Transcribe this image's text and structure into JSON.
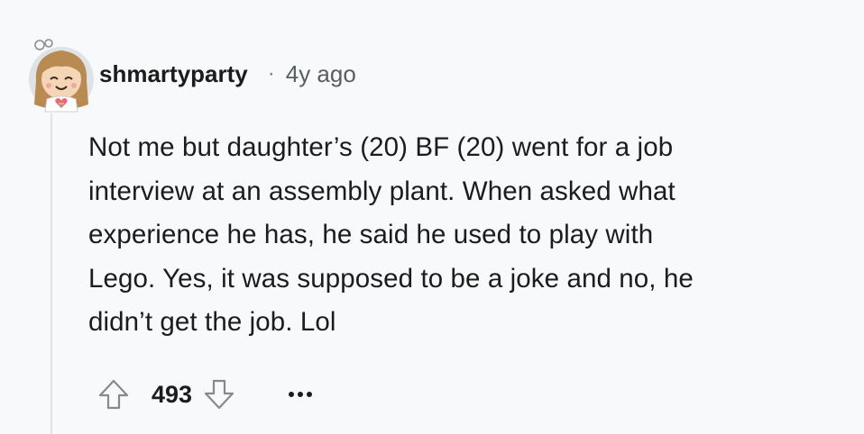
{
  "comment": {
    "author": "shmartyparty",
    "separator": "·",
    "age": "4y ago",
    "body_lines": [
      "Not me but daughter’s (20) BF (20) went for a job",
      "interview at an assembly plant. When asked what",
      "experience he has, he said he used to play with",
      "Lego. Yes, it was supposed to be a joke and no, he",
      "didn’t get the job. Lol"
    ],
    "score": "493",
    "icons": {
      "avatar": "avatar-cartoon-girl",
      "upvote": "arrow-up-outline-icon",
      "downvote": "arrow-down-outline-icon",
      "more": "ellipsis-horizontal-icon"
    }
  },
  "colors": {
    "background": "#f7f9fa",
    "text": "#1c1c1c",
    "muted": "#5a5e61",
    "thread_line": "#dfe3e6"
  }
}
